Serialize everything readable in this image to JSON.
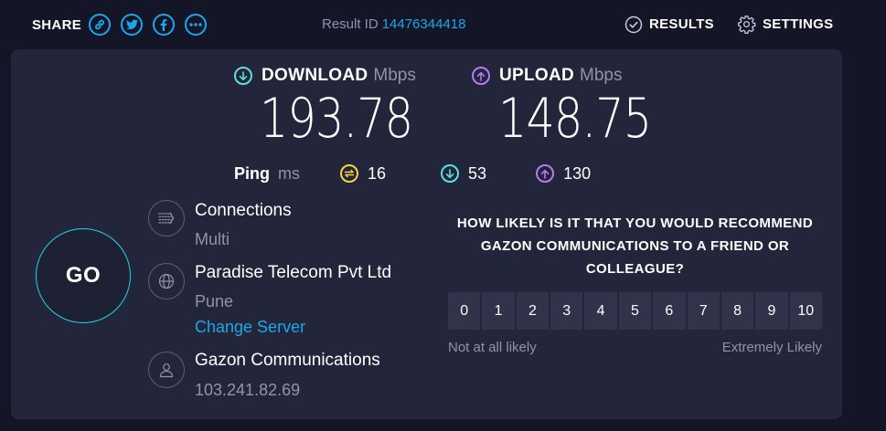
{
  "header": {
    "share_label": "SHARE",
    "share_icons": [
      "link-icon",
      "twitter-icon",
      "facebook-icon",
      "more-icon"
    ],
    "result_label": "Result ID",
    "result_id": "14476344418",
    "results_label": "RESULTS",
    "settings_label": "SETTINGS"
  },
  "speeds": {
    "download": {
      "label": "DOWNLOAD",
      "unit": "Mbps",
      "value": "193.78"
    },
    "upload": {
      "label": "UPLOAD",
      "unit": "Mbps",
      "value": "148.75"
    }
  },
  "ping": {
    "label": "Ping",
    "unit": "ms",
    "idle": "16",
    "download": "53",
    "upload": "130"
  },
  "go_label": "GO",
  "connections": {
    "title": "Connections",
    "value": "Multi"
  },
  "server": {
    "title": "Paradise Telecom Pvt Ltd",
    "location": "Pune",
    "change_label": "Change Server"
  },
  "isp": {
    "title": "Gazon Communications",
    "ip": "103.241.82.69"
  },
  "survey": {
    "question": "HOW LIKELY IS IT THAT YOU WOULD RECOMMEND GAZON COMMUNICATIONS TO A FRIEND OR COLLEAGUE?",
    "options": [
      "0",
      "1",
      "2",
      "3",
      "4",
      "5",
      "6",
      "7",
      "8",
      "9",
      "10"
    ],
    "low_label": "Not at all likely",
    "high_label": "Extremely Likely"
  },
  "colors": {
    "background": "#141526",
    "panel": "#23253a",
    "accent_blue": "#1ca7ec",
    "download": "#5ee0e0",
    "upload": "#b57bf5",
    "ping_idle": "#f5d547"
  }
}
